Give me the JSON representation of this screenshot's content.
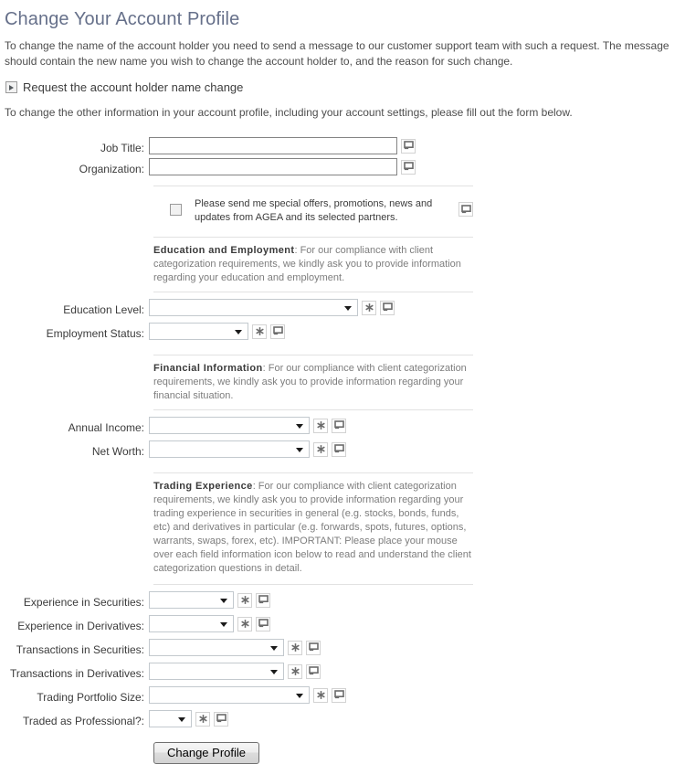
{
  "page": {
    "title": "Change Your Account Profile",
    "intro": "To change the name of the account holder you need to send a message to our customer support team with such a request. The message should contain the new name you wish to change the account holder to, and the reason for such change.",
    "name_change_link": "Request the account holder name change",
    "sub_intro": "To change the other information in your account profile, including your account settings, please fill out the form below."
  },
  "icons": {
    "expand": "triangle-right-icon",
    "info": "tooltip-screen-icon",
    "required": "required-star-icon"
  },
  "fields": {
    "job_title": {
      "label": "Job Title:",
      "value": "",
      "placeholder": ""
    },
    "organization": {
      "label": "Organization:",
      "value": "",
      "placeholder": ""
    },
    "education_level": {
      "label": "Education Level:",
      "value": ""
    },
    "employment_status": {
      "label": "Employment Status:",
      "value": ""
    },
    "annual_income": {
      "label": "Annual Income:",
      "value": ""
    },
    "net_worth": {
      "label": "Net Worth:",
      "value": ""
    },
    "experience_securities": {
      "label": "Experience in Securities:",
      "value": ""
    },
    "experience_derivatives": {
      "label": "Experience in Derivatives:",
      "value": ""
    },
    "transactions_securities": {
      "label": "Transactions in Securities:",
      "value": ""
    },
    "transactions_derivatives": {
      "label": "Transactions in Derivatives:",
      "value": ""
    },
    "trading_portfolio_size": {
      "label": "Trading Portfolio Size:",
      "value": ""
    },
    "traded_as_professional": {
      "label": "Traded as Professional?:",
      "value": ""
    }
  },
  "marketing_optin": {
    "text": "Please send me special offers, promotions, news and updates from AGEA and its selected partners.",
    "checked": false
  },
  "sections": {
    "education": {
      "heading": "Education and Employment",
      "body": ": For our compliance with client categorization requirements, we kindly ask you to provide information regarding your education and employment."
    },
    "financial": {
      "heading": "Financial Information",
      "body": ": For our compliance with client categorization requirements, we kindly ask you to provide information regarding your financial situation."
    },
    "trading": {
      "heading": "Trading Experience",
      "body": ": For our compliance with client categorization requirements, we kindly ask you to provide information regarding your trading experience in securities in general (e.g. stocks, bonds, funds, etc) and derivatives in particular (e.g. forwards, spots, futures, options, warrants, swaps, forex, etc). IMPORTANT: Please place your mouse over each field information icon below to read and understand the client categorization questions in detail."
    }
  },
  "submit": {
    "label": "Change Profile"
  },
  "colors": {
    "title": "#66708a",
    "text": "#4d4d4d",
    "note": "#7d7d7d",
    "separator": "#e2e2e2"
  }
}
